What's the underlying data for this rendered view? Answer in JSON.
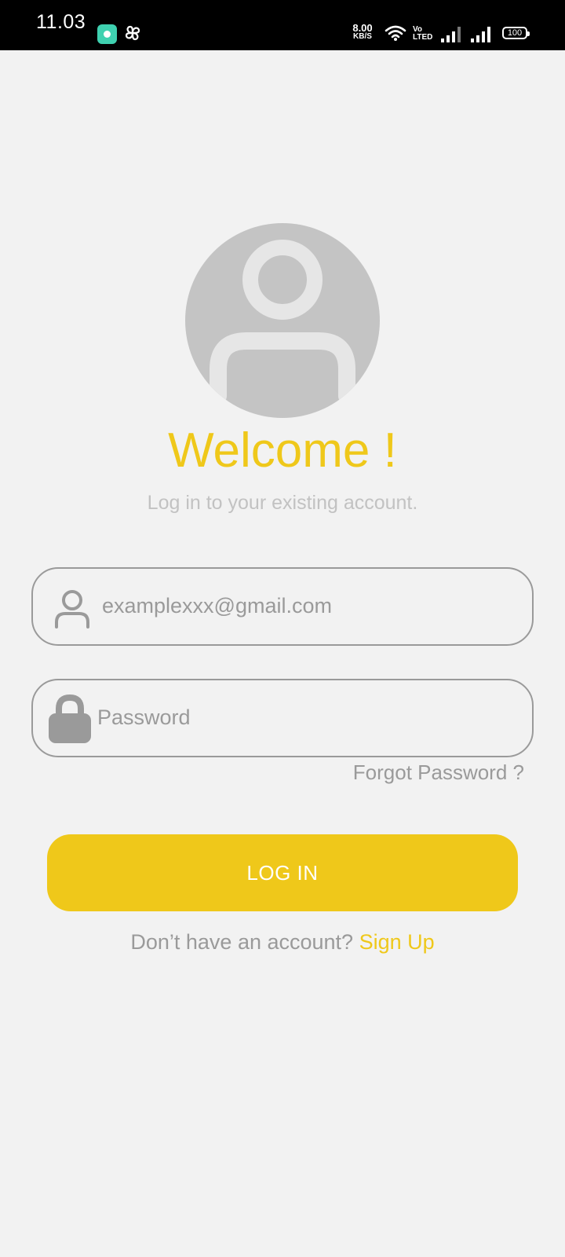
{
  "status_bar": {
    "time": "11.03",
    "net_speed_value": "8.00",
    "net_speed_unit": "KB/S",
    "volte_top": "Vo",
    "volte_bottom": "LTED",
    "battery": "100"
  },
  "login": {
    "welcome": "Welcome !",
    "subtitle": "Log in to your existing account.",
    "email_value": "examplexxx@gmail.com",
    "password_placeholder": "Password",
    "forgot_label": "Forgot Password ?",
    "login_label": "LOG IN",
    "no_account_text": "Don’t have an account?",
    "signup_label": "Sign Up"
  },
  "colors": {
    "accent": "#efc81a",
    "background": "#f2f2f2",
    "muted_text": "#9a9a9a"
  },
  "icons": {
    "avatar": "user-placeholder-icon",
    "email": "user-icon",
    "password": "lock-icon"
  }
}
